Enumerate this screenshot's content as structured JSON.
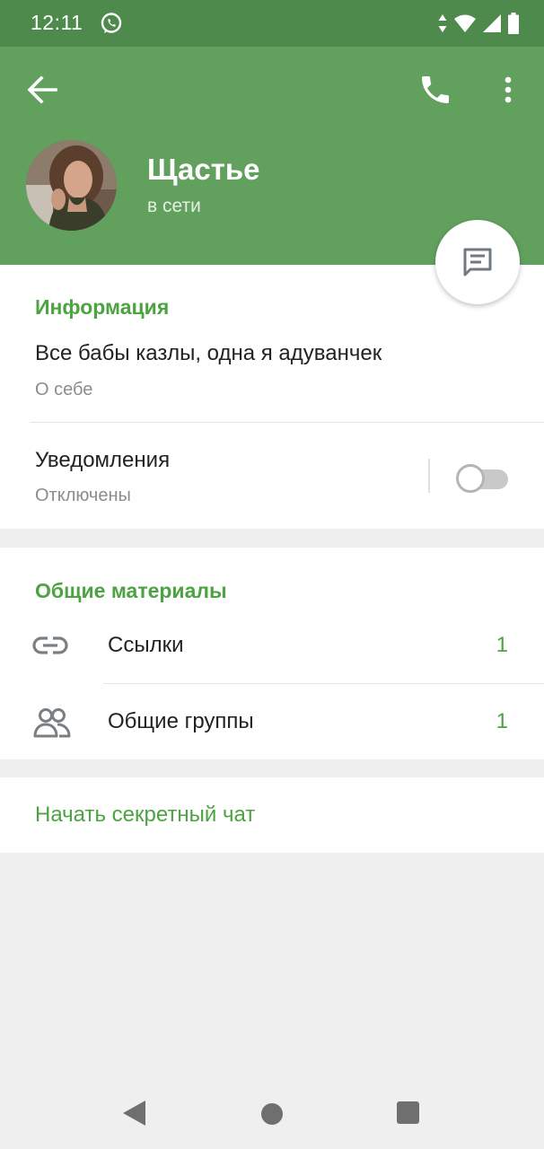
{
  "status_bar": {
    "time": "12:11",
    "icons": [
      "whatsapp-icon",
      "data-arrows-icon",
      "wifi-icon",
      "signal-icon",
      "battery-icon"
    ]
  },
  "header": {
    "icons": [
      "back-arrow-icon",
      "phone-icon",
      "more-vert-icon"
    ],
    "name": "Щастье",
    "status": "в сети",
    "color": "#62a05d"
  },
  "fab": {
    "icon": "message-icon"
  },
  "info": {
    "section_title": "Информация",
    "bio": "Все бабы казлы, одна я адуванчек",
    "bio_label": "О себе",
    "notifications_label": "Уведомления",
    "notifications_value": "Отключены",
    "notifications_on": false
  },
  "shared": {
    "section_title": "Общие материалы",
    "items": [
      {
        "icon": "link-icon",
        "label": "Ссылки",
        "count": "1"
      },
      {
        "icon": "group-icon",
        "label": "Общие группы",
        "count": "1"
      }
    ]
  },
  "secret_chat": {
    "label": "Начать секретный чат"
  },
  "accent_color": "#4ca341",
  "nav_bar": {
    "icons": [
      "nav-back-icon",
      "nav-home-icon",
      "nav-recents-icon"
    ]
  }
}
